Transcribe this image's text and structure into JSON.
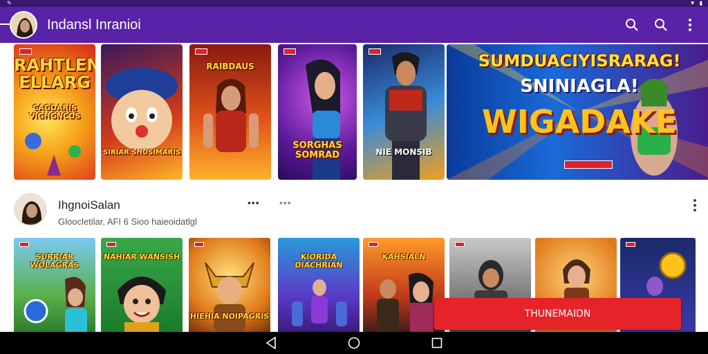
{
  "app": {
    "title": "Indansl Inranioi"
  },
  "banners": [
    {
      "text": "RAHTLEN ELLARG",
      "sub": "CAGDARIS VIGHGNCOS"
    },
    {
      "text": "SIRIAR SHUSIMARIS"
    },
    {
      "text": "RAIBDAUS"
    },
    {
      "text": "SORGHAS SOMRAD"
    },
    {
      "text": "NIE MONSIB"
    },
    {
      "text": "SUMDUACIYISRARAG!",
      "line2": "SNINIAGLA!",
      "line3": "WIGADAKE"
    }
  ],
  "profile": {
    "name": "IhgnoiSalan",
    "subtitle": "Gloocletilar, AFI 6 Sioo haieoidatlgl",
    "dots_primary": "•••",
    "dots_secondary": "•••"
  },
  "grid": [
    {
      "text": "SURRIAR WOLAGRAS"
    },
    {
      "text": "NAHIAR WANSISH"
    },
    {
      "text": "HIEHIA NOIPAGRIS"
    },
    {
      "text": "KIORIDA DIACHRIAN"
    },
    {
      "text": "KAHSIALN"
    },
    {
      "text": ""
    },
    {
      "text": ""
    },
    {
      "text": ""
    }
  ],
  "cta_label": "THUNEMAIDN",
  "colors": {
    "appbar": "#5a22a6",
    "statusbar": "#3a176e",
    "cta": "#e62329"
  }
}
